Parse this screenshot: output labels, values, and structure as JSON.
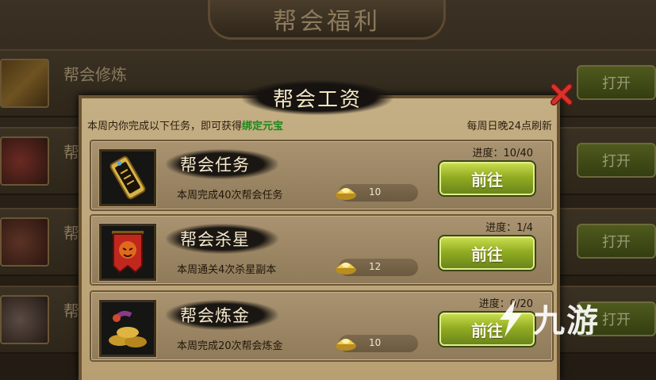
{
  "background": {
    "title": "帮会福利",
    "rows": [
      {
        "name": "帮会修炼",
        "button": "打开"
      },
      {
        "name": "帮",
        "button": "打开"
      },
      {
        "name": "帮",
        "button": "打开"
      },
      {
        "name": "帮",
        "button": "打开"
      }
    ]
  },
  "modal": {
    "title": "帮会工资",
    "info_text": "本周内你完成以下任务，即可获得",
    "info_highlight": "绑定元宝",
    "refresh_text": "每周日晚24点刷新",
    "tasks": [
      {
        "name": "帮会任务",
        "desc": "本周完成40次帮会任务",
        "reward": "10",
        "progress": "进度：10/40",
        "button": "前往",
        "icon": "guild-token-icon"
      },
      {
        "name": "帮会杀星",
        "desc": "本周通关4次杀星副本",
        "reward": "12",
        "progress": "进度：1/4",
        "button": "前往",
        "icon": "red-banner-icon"
      },
      {
        "name": "帮会炼金",
        "desc": "本周完成20次帮会炼金",
        "reward": "10",
        "progress": "进度：0/20",
        "button": "前往",
        "icon": "gold-ingots-icon"
      }
    ]
  },
  "watermark": {
    "text": "九游"
  },
  "colors": {
    "highlight": "#1b8a18",
    "button_green": "#93ad22",
    "close_red": "#c8251c"
  }
}
